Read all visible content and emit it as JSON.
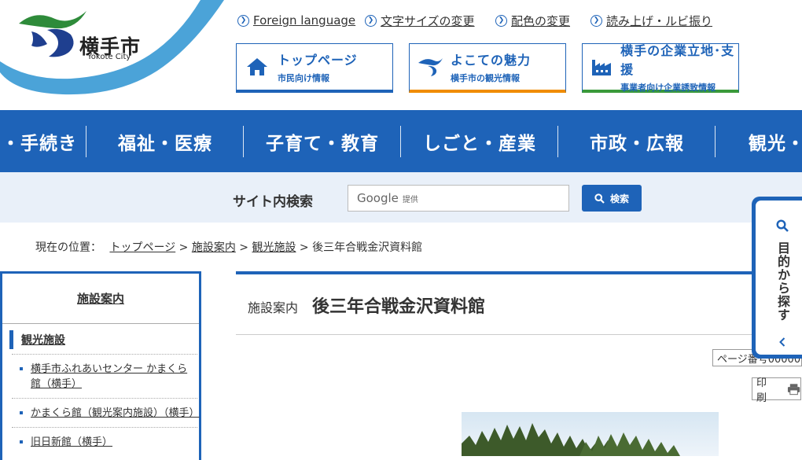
{
  "header": {
    "city_name": "横手市",
    "city_name_en": "Yokote City",
    "utility_links": [
      {
        "label": "Foreign language"
      },
      {
        "label": "文字サイズの変更"
      },
      {
        "label": "配色の変更"
      },
      {
        "label": "読み上げ・ルビ振り"
      }
    ],
    "quick_buttons": [
      {
        "title": "トップページ",
        "subtitle": "市民向け情報",
        "icon": "house-icon"
      },
      {
        "title": "よこての魅力",
        "subtitle": "横手市の観光情報",
        "icon": "city-mark-icon"
      },
      {
        "title": "横手の企業立地･支援",
        "subtitle": "事業者向け企業誘致情報",
        "icon": "factory-icon"
      }
    ]
  },
  "global_nav": {
    "items": [
      "・手続き",
      "福祉・医療",
      "子育て・教育",
      "しごと・産業",
      "市政・広報",
      "観光・"
    ]
  },
  "search": {
    "label": "サイト内検索",
    "google_text": "Google",
    "powered": "提供",
    "button_label": "検索"
  },
  "breadcrumb": {
    "prefix": "現在の位置：",
    "items": [
      "トップページ",
      "施設案内",
      "観光施設"
    ],
    "separator": ">",
    "current": "後三年合戦金沢資料館"
  },
  "sidebar": {
    "heading": "施設案内",
    "subheading": "観光施設",
    "items": [
      {
        "label": "横手市ふれあいセンター かまくら館（横手）"
      },
      {
        "label": "かまくら館（観光案内施設）（横手）"
      },
      {
        "label": "旧日新館（横手）"
      }
    ]
  },
  "main": {
    "category": "施設案内",
    "title": "後三年合戦金沢資料館",
    "page_id": "ページ番号00000",
    "print_label": "印刷"
  },
  "drawer": {
    "label": "目的から探す"
  },
  "colors": {
    "primary": "#1e63b8",
    "accent_orange": "#f08c00",
    "accent_green": "#3a9a3a",
    "search_band": "#e9f0f9"
  }
}
